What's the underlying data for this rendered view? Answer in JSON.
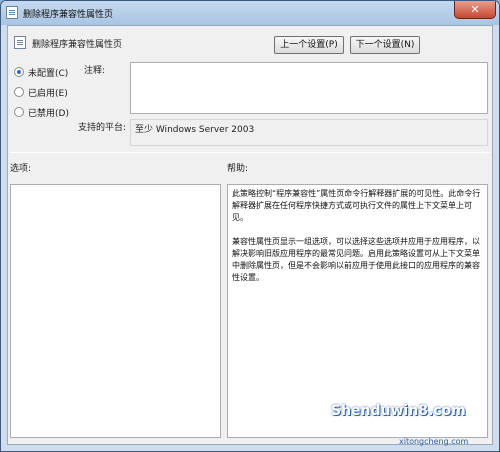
{
  "window": {
    "title": "删除程序兼容性属性页",
    "close_glyph": "✕"
  },
  "header": {
    "title": "删除程序兼容性属性页"
  },
  "nav": {
    "prev_label": "上一个设置(P)",
    "next_label": "下一个设置(N)"
  },
  "state": {
    "options": [
      {
        "label": "未配置(C)",
        "checked": true
      },
      {
        "label": "已启用(E)",
        "checked": false
      },
      {
        "label": "已禁用(D)",
        "checked": false
      }
    ]
  },
  "comment": {
    "label": "注释:",
    "value": ""
  },
  "platform": {
    "label": "支持的平台:",
    "value": "至少 Windows Server 2003"
  },
  "sections": {
    "options_label": "选项:",
    "help_label": "帮助:"
  },
  "help": {
    "paragraphs": [
      "此策略控制“程序兼容性”属性页命令行解释器扩展的可见性。此命令行解释器扩展在任何程序快捷方式或可执行文件的属性上下文菜单上可见。",
      "兼容性属性页显示一组选项，可以选择这些选项并应用于应用程序，以解决影响旧版应用程序的最常见问题。启用此策略设置可从上下文菜单中删除属性页，但是不会影响以前应用于使用此接口的应用程序的兼容性设置。"
    ]
  },
  "watermark": {
    "text": "Shenduwin8.com",
    "subtext": "xitongcheng.com"
  }
}
